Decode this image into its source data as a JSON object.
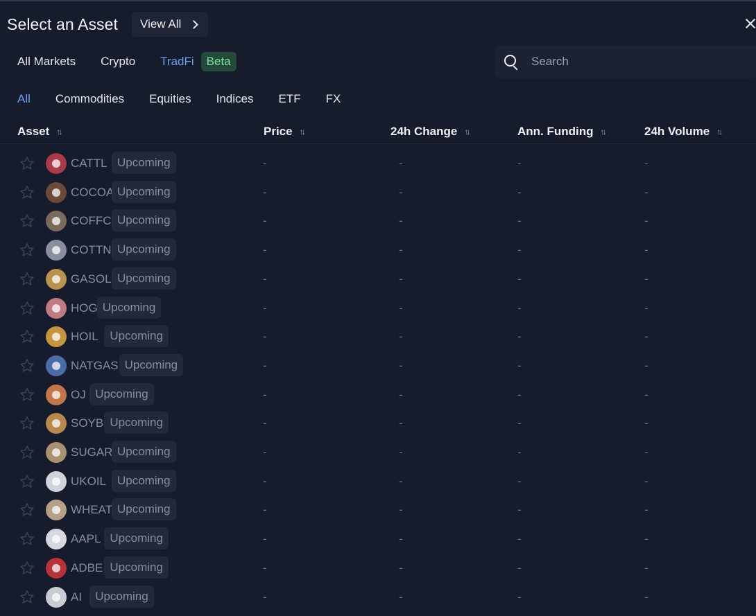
{
  "header": {
    "title": "Select an Asset",
    "view_all": "View All"
  },
  "markets": {
    "tabs": [
      "All Markets",
      "Crypto",
      "TradFi"
    ],
    "active": "TradFi",
    "beta_badge": "Beta"
  },
  "search": {
    "placeholder": "Search"
  },
  "categories": {
    "tabs": [
      "All",
      "Commodities",
      "Equities",
      "Indices",
      "ETF",
      "FX"
    ],
    "active": "All"
  },
  "table": {
    "columns": [
      "Asset",
      "Price",
      "24h Change",
      "Ann. Funding",
      "24h Volume"
    ],
    "sort_glyph": "↑↓",
    "rows": [
      {
        "symbol": "CATTL",
        "status": "Upcoming",
        "icon": "cattle-icon",
        "color": "#a83a4a",
        "price": "-",
        "change": "-",
        "funding": "-",
        "volume": "-"
      },
      {
        "symbol": "COCOA",
        "status": "Upcoming",
        "icon": "cocoa-icon",
        "color": "#6b4a3c",
        "price": "-",
        "change": "-",
        "funding": "-",
        "volume": "-"
      },
      {
        "symbol": "COFFC",
        "status": "Upcoming",
        "icon": "coffee-icon",
        "color": "#7a6a5e",
        "price": "-",
        "change": "-",
        "funding": "-",
        "volume": "-"
      },
      {
        "symbol": "COTTN",
        "status": "Upcoming",
        "icon": "cotton-icon",
        "color": "#8a8f9e",
        "price": "-",
        "change": "-",
        "funding": "-",
        "volume": "-"
      },
      {
        "symbol": "GASOL",
        "status": "Upcoming",
        "icon": "gasoline-icon",
        "color": "#b8924e",
        "price": "-",
        "change": "-",
        "funding": "-",
        "volume": "-"
      },
      {
        "symbol": "HOG",
        "status": "Upcoming",
        "icon": "hog-icon",
        "color": "#c07a82",
        "price": "-",
        "change": "-",
        "funding": "-",
        "volume": "-"
      },
      {
        "symbol": "HOIL",
        "status": "Upcoming",
        "icon": "heating-oil-icon",
        "color": "#c49540",
        "price": "-",
        "change": "-",
        "funding": "-",
        "volume": "-"
      },
      {
        "symbol": "NATGAS",
        "status": "Upcoming",
        "icon": "natural-gas-icon",
        "color": "#4a6aa8",
        "price": "-",
        "change": "-",
        "funding": "-",
        "volume": "-"
      },
      {
        "symbol": "OJ",
        "status": "Upcoming",
        "icon": "orange-juice-icon",
        "color": "#c2764a",
        "price": "-",
        "change": "-",
        "funding": "-",
        "volume": "-"
      },
      {
        "symbol": "SOYB",
        "status": "Upcoming",
        "icon": "soybean-icon",
        "color": "#b8884e",
        "price": "-",
        "change": "-",
        "funding": "-",
        "volume": "-"
      },
      {
        "symbol": "SUGAR",
        "status": "Upcoming",
        "icon": "sugar-icon",
        "color": "#a89070",
        "price": "-",
        "change": "-",
        "funding": "-",
        "volume": "-"
      },
      {
        "symbol": "UKOIL",
        "status": "Upcoming",
        "icon": "oil-drop-icon",
        "color": "#d0d3da",
        "price": "-",
        "change": "-",
        "funding": "-",
        "volume": "-"
      },
      {
        "symbol": "WHEAT",
        "status": "Upcoming",
        "icon": "wheat-icon",
        "color": "#b5a088",
        "price": "-",
        "change": "-",
        "funding": "-",
        "volume": "-"
      },
      {
        "symbol": "AAPL",
        "status": "Upcoming",
        "icon": "apple-icon",
        "color": "#d6d8de",
        "price": "-",
        "change": "-",
        "funding": "-",
        "volume": "-"
      },
      {
        "symbol": "ADBE",
        "status": "Upcoming",
        "icon": "adobe-icon",
        "color": "#b8323a",
        "price": "-",
        "change": "-",
        "funding": "-",
        "volume": "-"
      },
      {
        "symbol": "AI",
        "status": "Upcoming",
        "icon": "c3ai-icon",
        "color": "#c9ccd3",
        "price": "-",
        "change": "-",
        "funding": "-",
        "volume": "-"
      }
    ]
  }
}
